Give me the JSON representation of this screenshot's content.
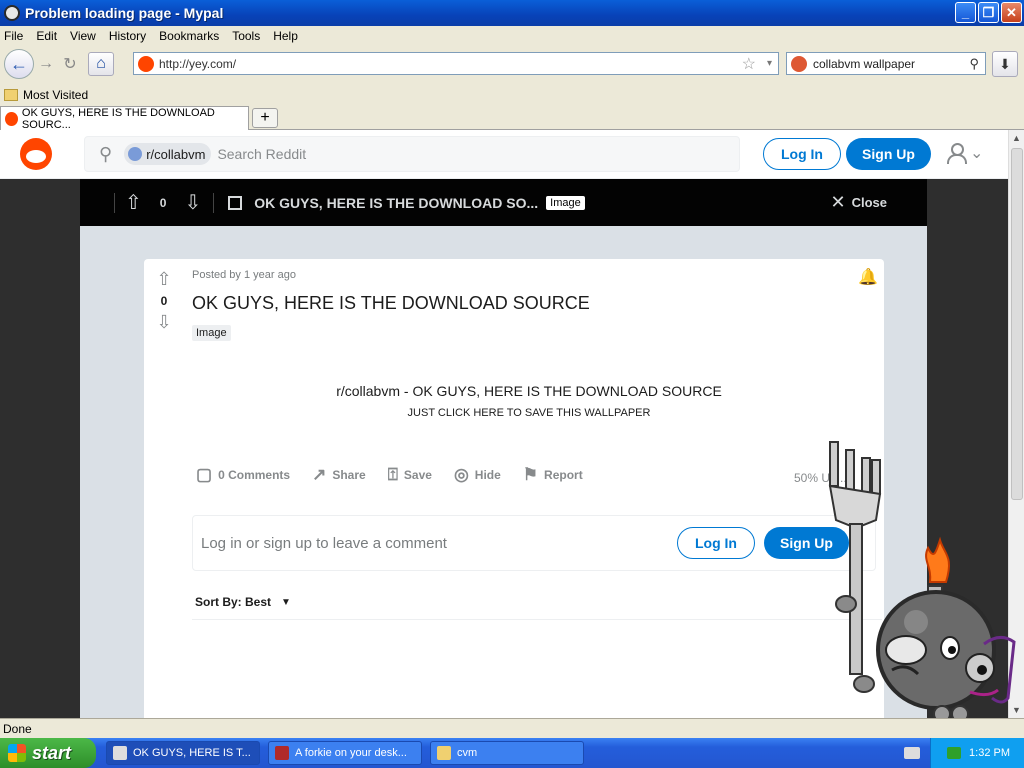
{
  "window": {
    "title": "Problem loading page - Mypal",
    "minimize": "_",
    "restore": "❐",
    "close": "✕"
  },
  "menu": [
    "File",
    "Edit",
    "View",
    "History",
    "Bookmarks",
    "Tools",
    "Help"
  ],
  "nav": {
    "back": "←",
    "forward": "→",
    "reload": "↻",
    "home": "⌂",
    "url": "http://yey.com/",
    "star": "☆",
    "dropdown": "▾",
    "download": "⬇"
  },
  "search": {
    "value": "collabvm wallpaper",
    "icon": "⚲"
  },
  "bookmarks": {
    "most_visited": "Most Visited"
  },
  "tab": {
    "label": "OK GUYS, HERE IS THE DOWNLOAD SOURC...",
    "new": "+"
  },
  "reddit": {
    "search_chip": "Subreddit Icon",
    "search_chip_text": "r/collabvm",
    "search_placeholder": "Search Reddit",
    "login": "Log In",
    "signup": "Sign Up"
  },
  "postbar": {
    "upvote": "⇧",
    "downvote": "⇩",
    "count": "0",
    "title": "OK GUYS, HERE IS THE DOWNLOAD SO...",
    "tag": "Image",
    "close": "Close",
    "close_x": "✕"
  },
  "post": {
    "meta": "Posted by 1 year ago",
    "upvote": "⇧",
    "downvote": "⇩",
    "count": "0",
    "title": "OK GUYS, HERE IS THE DOWNLOAD SOURCE",
    "flair": "Image",
    "bell": "🔔",
    "embed_title": "r/collabvm - OK GUYS, HERE IS THE DOWNLOAD SOURCE",
    "embed_sub": "JUST CLICK HERE TO SAVE THIS WALLPAPER",
    "actions": [
      {
        "icon": "▢",
        "label": "0 Comments"
      },
      {
        "icon": "↗",
        "label": "Share"
      },
      {
        "icon": "⍐",
        "label": "Save"
      },
      {
        "icon": "◎",
        "label": "Hide"
      },
      {
        "icon": "⚑",
        "label": "Report"
      }
    ],
    "upvoted": "50% Up...",
    "comment_placeholder": "Log in or sign up to leave a comment",
    "comment_login": "Log In",
    "comment_signup": "Sign Up",
    "sort": "Sort By: Best",
    "sort_caret": "▼"
  },
  "status": "Done",
  "taskbar": {
    "start": "start",
    "tasks": [
      "OK GUYS, HERE IS T...",
      "A forkie on your desk...",
      "cvm"
    ],
    "time": "1:32 PM"
  },
  "colors": {
    "reddit_orange": "#ff4500",
    "reddit_blue": "#0079d3",
    "xp_blue": "#0842b8"
  }
}
